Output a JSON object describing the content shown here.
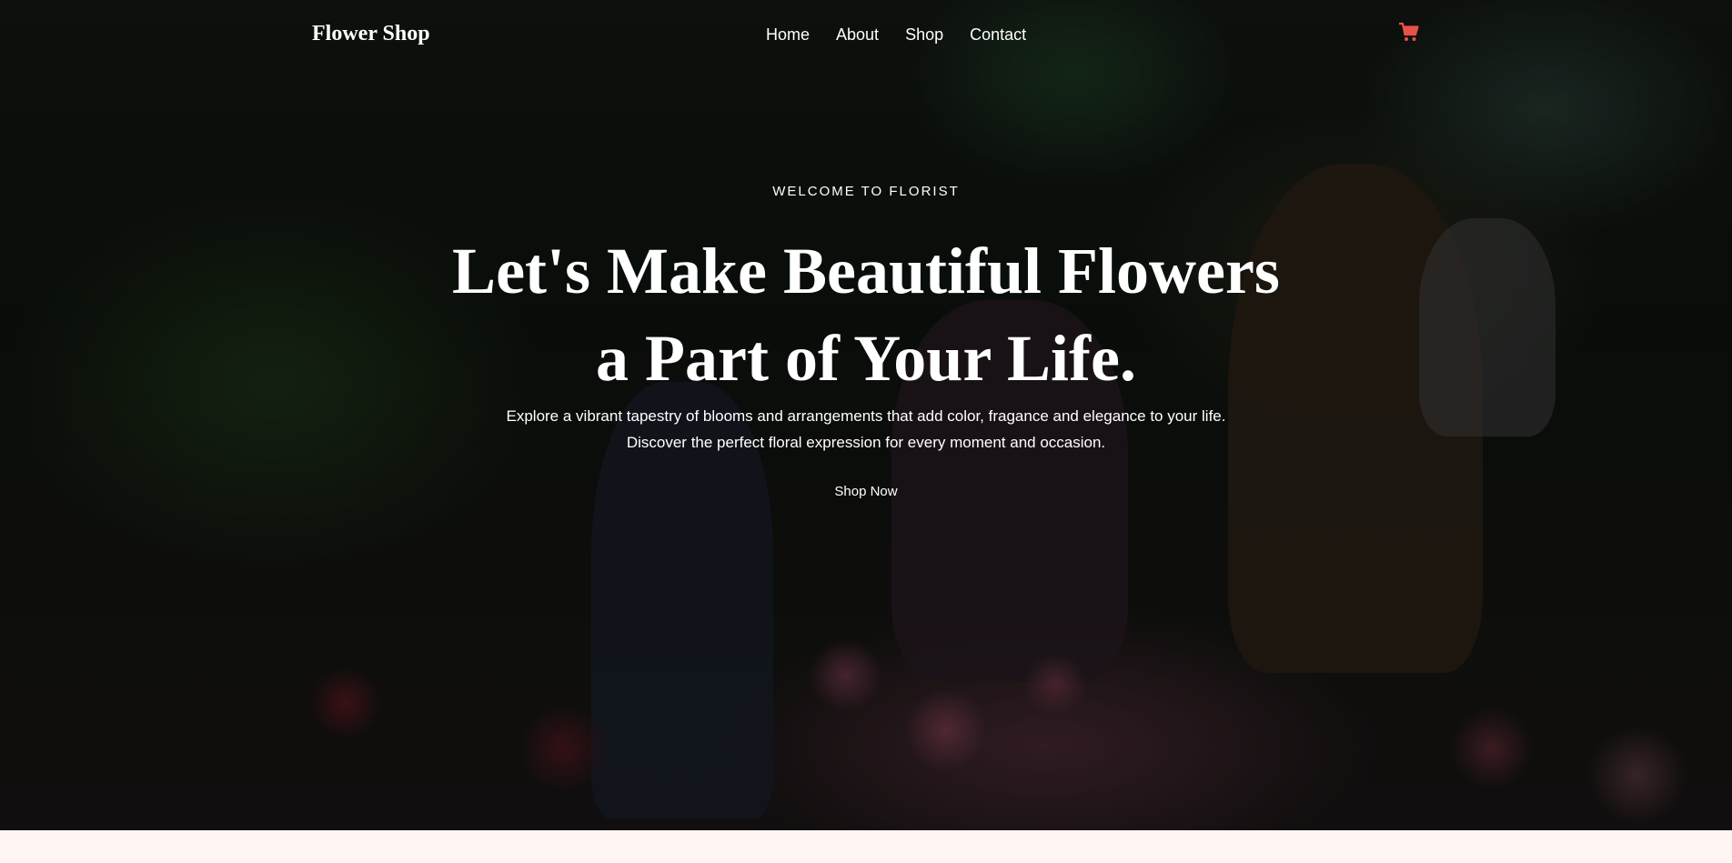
{
  "nav": {
    "logo": "Flower Shop",
    "links": [
      "Home",
      "About",
      "Shop",
      "Contact"
    ],
    "cart_icon": "shopping-cart-icon",
    "cart_color": "#e8514a"
  },
  "hero": {
    "eyebrow": "WELCOME TO FLORIST",
    "headline_line1": "Let's Make Beautiful Flowers",
    "headline_line2": "a Part of Your Life.",
    "description_line1": "Explore a vibrant tapestry of blooms and arrangements that add color, fragance and elegance to your life.",
    "description_line2": "Discover the perfect floral expression for every moment and occasion.",
    "cta_label": "Shop Now"
  },
  "colors": {
    "text": "#ffffff",
    "page_background": "#fff6f4"
  }
}
